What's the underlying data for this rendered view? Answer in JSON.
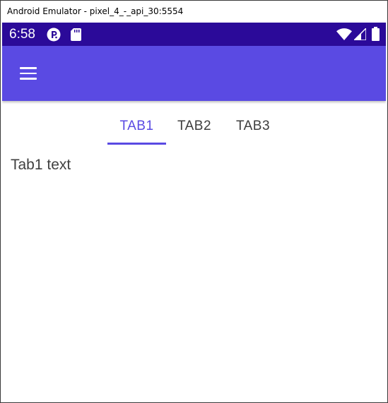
{
  "window": {
    "title": "Android Emulator - pixel_4_-_api_30:5554"
  },
  "statusbar": {
    "time": "6:58",
    "left_icons": [
      "app-p-icon",
      "sd-card-icon"
    ],
    "right_icons": [
      "wifi-icon",
      "cellular-signal-icon",
      "battery-icon"
    ],
    "background": "#2b0a99"
  },
  "appbar": {
    "menu_icon": "hamburger-menu-icon",
    "background": "#5a4ae3"
  },
  "tabs": [
    {
      "label": "TAB1",
      "selected": true
    },
    {
      "label": "TAB2",
      "selected": false
    },
    {
      "label": "TAB3",
      "selected": false
    }
  ],
  "content": {
    "text": "Tab1 text"
  },
  "colors": {
    "accent": "#5a4ae3",
    "tab_text": "#3d3d3d"
  }
}
